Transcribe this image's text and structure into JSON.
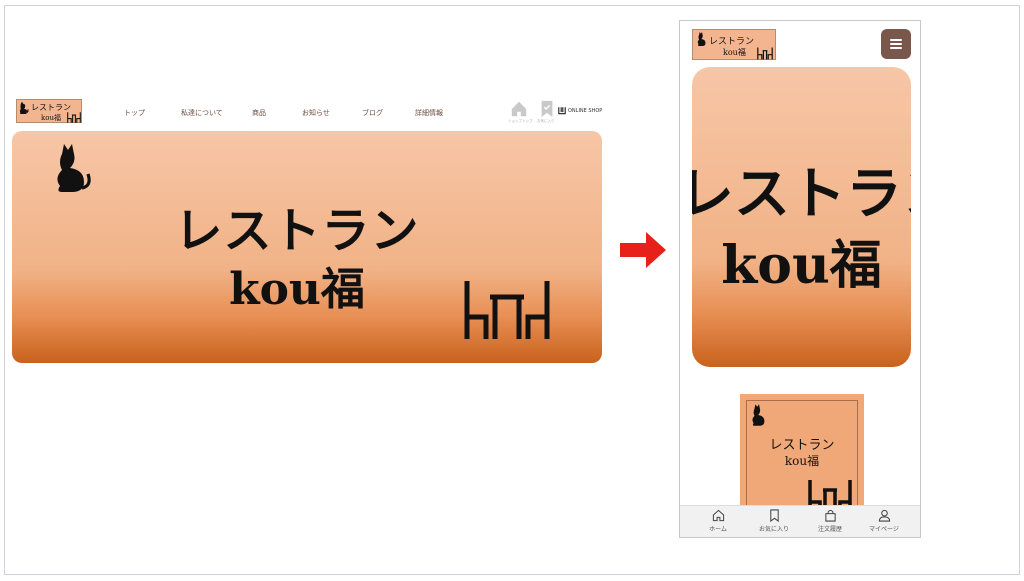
{
  "desktop": {
    "logo": {
      "line1": "レストラン",
      "line2": "kou福"
    },
    "nav": [
      "トップ",
      "私達について",
      "商品",
      "お知らせ",
      "ブログ",
      "詳細情報"
    ],
    "utility": {
      "home_label": "ショップトップ",
      "fav_label": "お気に入り",
      "shop_label": "ONLINE SHOP"
    },
    "hero": {
      "line1": "レストラン",
      "line2": "kou福"
    }
  },
  "mobile": {
    "logo": {
      "line1": "レストラン",
      "line2": "kou福"
    },
    "hero": {
      "line1": "レストラン",
      "line2": "kou福"
    },
    "card": {
      "line1": "レストラン",
      "line2": "kou福"
    },
    "tabs": [
      {
        "label": "ホーム",
        "icon": "home-icon"
      },
      {
        "label": "お気に入り",
        "icon": "bookmark-icon"
      },
      {
        "label": "注文履歴",
        "icon": "bag-icon"
      },
      {
        "label": "マイページ",
        "icon": "user-icon"
      }
    ]
  },
  "colors": {
    "hero_top": "#f7c6a7",
    "hero_bottom": "#c9621d",
    "hamburger": "#7a574b",
    "arrow": "#e8201a"
  }
}
